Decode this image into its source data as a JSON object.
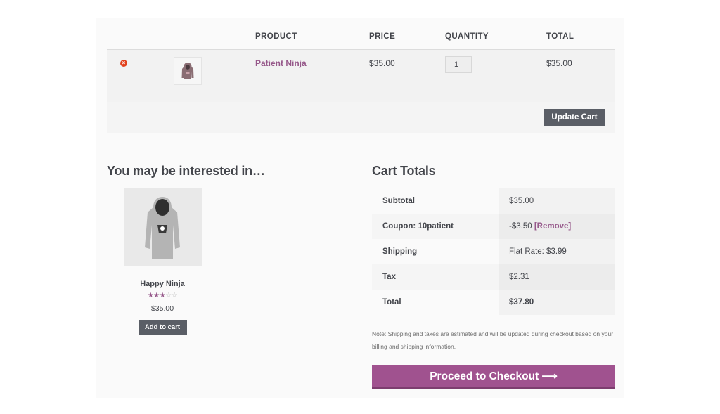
{
  "cart": {
    "headers": {
      "product": "PRODUCT",
      "price": "PRICE",
      "quantity": "QUANTITY",
      "total": "TOTAL"
    },
    "items": [
      {
        "remove_icon": "remove-x-icon",
        "thumbnail": "hoodie-thumbnail",
        "name": "Patient Ninja",
        "price": "$35.00",
        "quantity": "1",
        "total": "$35.00"
      }
    ],
    "update_label": "Update Cart"
  },
  "related": {
    "title": "You may be interested in…",
    "products": [
      {
        "image": "grey-hoodie-image",
        "name": "Happy Ninja",
        "rating": 3,
        "rating_max": 5,
        "price": "$35.00",
        "button_label": "Add to cart"
      }
    ]
  },
  "totals": {
    "title": "Cart Totals",
    "rows": [
      {
        "label": "Subtotal",
        "value": "$35.00"
      },
      {
        "label": "Coupon: 10patient",
        "value": "-$3.50",
        "link": "[Remove]"
      },
      {
        "label": "Shipping",
        "value": "Flat Rate: $3.99"
      },
      {
        "label": "Tax",
        "value": "$2.31"
      },
      {
        "label": "Total",
        "value": "$37.80"
      }
    ],
    "note": "Note: Shipping and taxes are estimated and will be updated during checkout based on your billing and shipping information.",
    "checkout_label": "Proceed to Checkout",
    "checkout_arrow": "⟶"
  },
  "colors": {
    "accent": "#96588a",
    "checkout": "#a0528f",
    "button": "#5a5e66",
    "remove": "#e2401c"
  }
}
